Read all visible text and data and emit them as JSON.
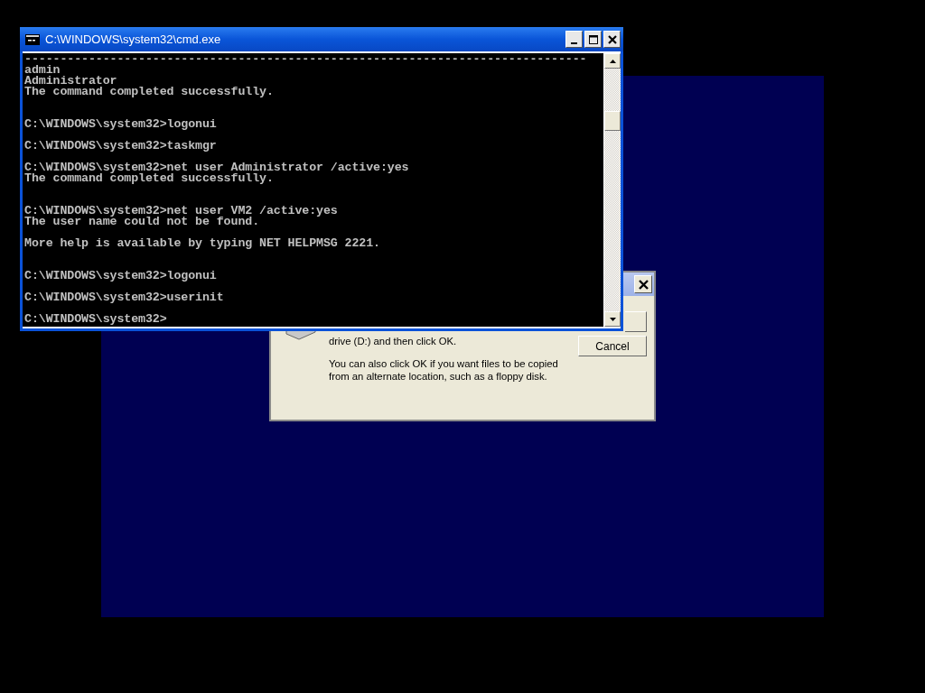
{
  "console_window": {
    "title": "C:\\WINDOWS\\system32\\cmd.exe",
    "lines": [
      {
        "kind": "text",
        "text": "-------------------------------------------------------------------------------"
      },
      {
        "kind": "text",
        "text": "admin"
      },
      {
        "kind": "text",
        "text": "Administrator"
      },
      {
        "kind": "text",
        "text": "The command completed successfully."
      },
      {
        "kind": "blank"
      },
      {
        "kind": "blank"
      },
      {
        "kind": "text",
        "text": "C:\\WINDOWS\\system32>logonui"
      },
      {
        "kind": "blank"
      },
      {
        "kind": "text",
        "text": "C:\\WINDOWS\\system32>taskmgr"
      },
      {
        "kind": "blank"
      },
      {
        "kind": "text",
        "text": "C:\\WINDOWS\\system32>net user Administrator /active:yes"
      },
      {
        "kind": "text",
        "text": "The command completed successfully."
      },
      {
        "kind": "blank"
      },
      {
        "kind": "blank"
      },
      {
        "kind": "text",
        "text": "C:\\WINDOWS\\system32>net user VM2 /active:yes"
      },
      {
        "kind": "text",
        "text": "The user name could not be found."
      },
      {
        "kind": "blank"
      },
      {
        "kind": "text",
        "text": "More help is available by typing NET HELPMSG 2221."
      },
      {
        "kind": "blank"
      },
      {
        "kind": "blank"
      },
      {
        "kind": "text",
        "text": "C:\\WINDOWS\\system32>logonui"
      },
      {
        "kind": "blank"
      },
      {
        "kind": "text",
        "text": "C:\\WINDOWS\\system32>userinit"
      },
      {
        "kind": "blank"
      },
      {
        "kind": "text",
        "text": "C:\\WINDOWS\\system32>"
      }
    ]
  },
  "dialog": {
    "paragraphs": [
      "drive (D:) and then click OK.",
      "You can also click OK if you want files to be copied from an alternate location, such as a floppy disk."
    ],
    "buttons": [
      "Cancel"
    ]
  }
}
